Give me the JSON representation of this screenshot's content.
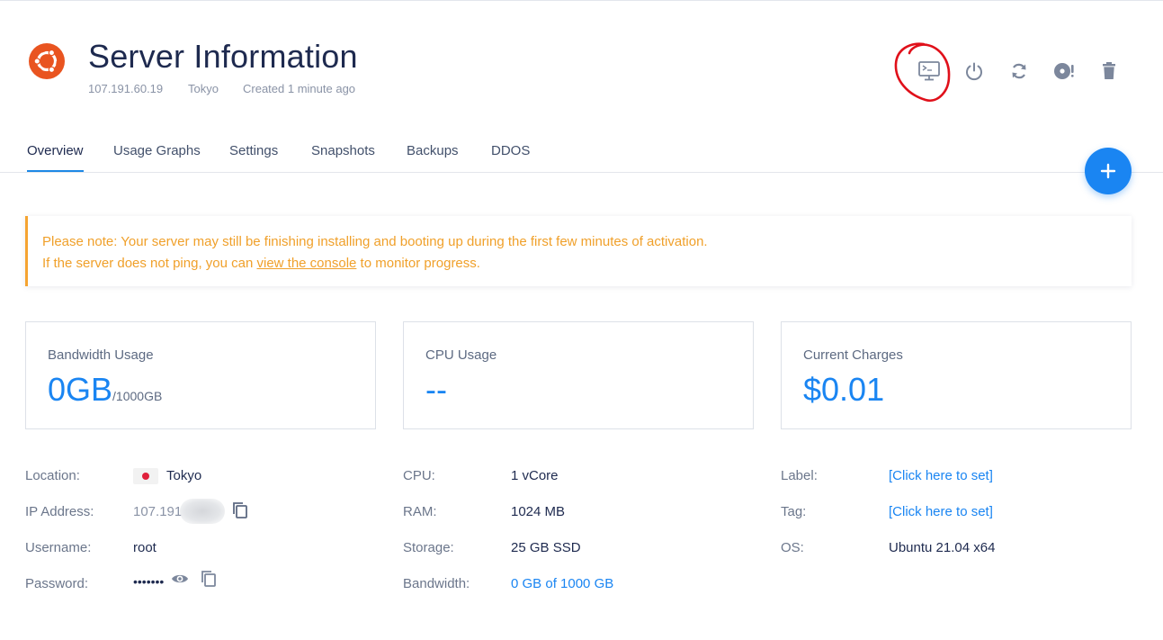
{
  "header": {
    "title": "Server Information",
    "ip": "107.191.60.19",
    "location": "Tokyo",
    "created": "Created 1 minute ago",
    "actions": [
      "console-icon",
      "power-icon",
      "restart-icon",
      "reinstall-icon",
      "delete-icon"
    ]
  },
  "tabs": [
    "Overview",
    "Usage Graphs",
    "Settings",
    "Snapshots",
    "Backups",
    "DDOS"
  ],
  "active_tab": "Overview",
  "notice": {
    "line1": "Please note: Your server may still be finishing installing and booting up during the first few minutes of activation.",
    "line2_before": "If the server does not ping, you can ",
    "line2_link": "view the console",
    "line2_after": " to monitor progress."
  },
  "cards": {
    "bandwidth": {
      "label": "Bandwidth Usage",
      "value": "0GB",
      "unit": "/1000GB"
    },
    "cpu": {
      "label": "CPU Usage",
      "value": "--"
    },
    "charges": {
      "label": "Current Charges",
      "value": "$0.01"
    }
  },
  "details": {
    "location_label": "Location:",
    "location_value": "Tokyo",
    "ip_label": "IP Address:",
    "ip_value": "107.191",
    "username_label": "Username:",
    "username_value": "root",
    "password_label": "Password:",
    "password_value": "•••••••",
    "cpu_label": "CPU:",
    "cpu_value": "1 vCore",
    "ram_label": "RAM:",
    "ram_value": "1024 MB",
    "storage_label": "Storage:",
    "storage_value": "25 GB SSD",
    "bandwidth_label": "Bandwidth:",
    "bandwidth_value": "0 GB of 1000 GB",
    "label_label": "Label:",
    "label_value": "[Click here to set]",
    "tag_label": "Tag:",
    "tag_value": "[Click here to set]",
    "os_label": "OS:",
    "os_value": "Ubuntu 21.04 x64"
  },
  "colors": {
    "accent": "#1a85f2",
    "warning": "#f0a02a",
    "ubuntu": "#e95420",
    "annotation": "#e0101a"
  }
}
